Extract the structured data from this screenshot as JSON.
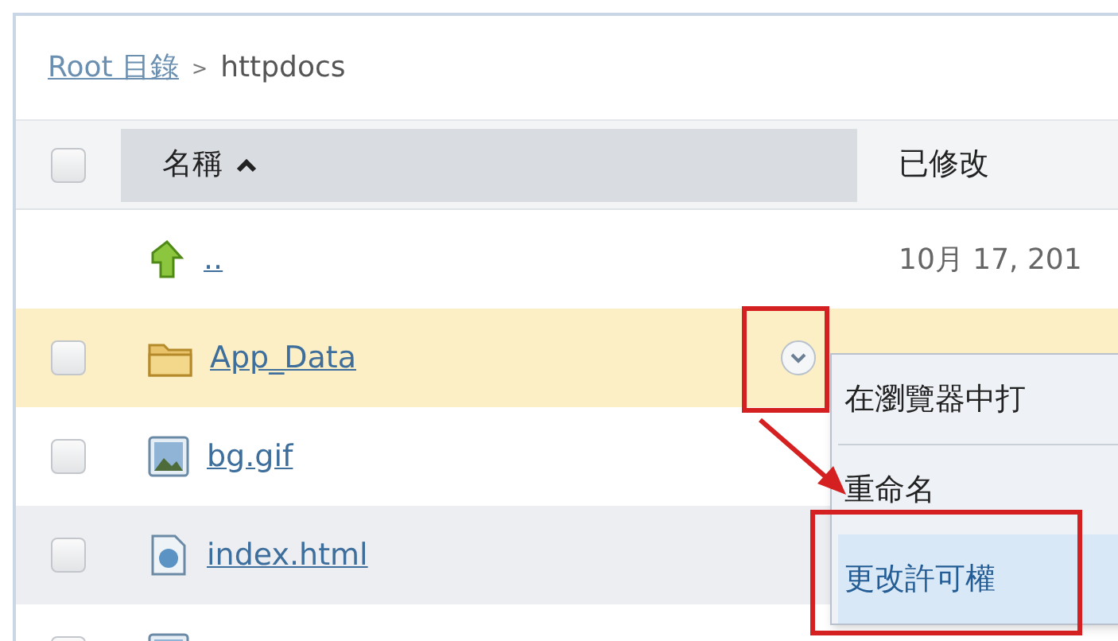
{
  "breadcrumb": {
    "links": [
      "Root 目錄"
    ],
    "separator": ">",
    "current": "httpdocs"
  },
  "header": {
    "checked": false,
    "columns": [
      {
        "label": "名稱",
        "sorted": true
      },
      {
        "label": "已修改",
        "sorted": false
      }
    ]
  },
  "rows": [
    {
      "kind": "parent",
      "name": "..",
      "modified": "10月 17, 201",
      "selected": false
    },
    {
      "kind": "folder",
      "name": "App_Data",
      "checked": false,
      "selected": true
    },
    {
      "kind": "image",
      "name": "bg.gif",
      "checked": false,
      "selected": false
    },
    {
      "kind": "html",
      "name": "index.html",
      "checked": false,
      "selected": false
    },
    {
      "kind": "image",
      "checked": false,
      "selected": false
    }
  ],
  "context_menu": {
    "items": [
      {
        "label": "在瀏覽器中打",
        "selected": false
      },
      {
        "label": "重命名",
        "selected": false
      },
      {
        "label": "更改許可權",
        "selected": true
      }
    ]
  }
}
